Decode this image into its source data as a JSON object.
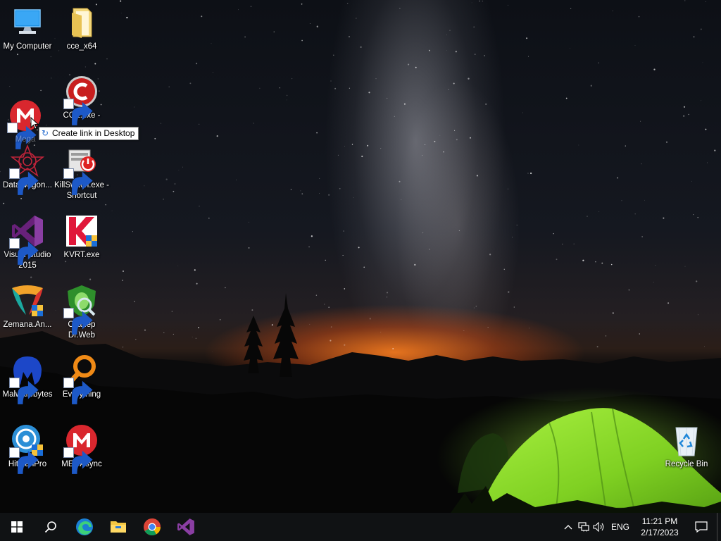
{
  "desktop": {
    "icons": [
      {
        "label": "My Computer"
      },
      {
        "label": "cce_x64"
      },
      {
        "label": "Mega"
      },
      {
        "label": "CCE.exe - Shortcut"
      },
      {
        "label": "DataWagon..."
      },
      {
        "label": "KillSwitch.exe - Shortcut"
      },
      {
        "label": "Visual Studio 2015"
      },
      {
        "label": "KVRT.exe"
      },
      {
        "label": "Zemana.An..."
      },
      {
        "label": "Сканер Dr.Web"
      },
      {
        "label": "Malwarebytes"
      },
      {
        "label": "Everything"
      },
      {
        "label": "HitmanPro"
      },
      {
        "label": "MEGAsync"
      },
      {
        "label": "Recycle Bin"
      }
    ],
    "tooltip": "Create link in Desktop"
  },
  "taskbar": {
    "buttons": [
      "start-icon",
      "search-icon",
      "edge-icon",
      "file-explorer-icon",
      "chrome-icon",
      "visual-studio-icon"
    ],
    "tray": {
      "language": "ENG",
      "time": "11:21 PM",
      "date": "2/17/2023"
    }
  },
  "colors": {
    "taskbar": "#101214",
    "tent": "#8be02c",
    "sunset": "#f07a1e"
  }
}
